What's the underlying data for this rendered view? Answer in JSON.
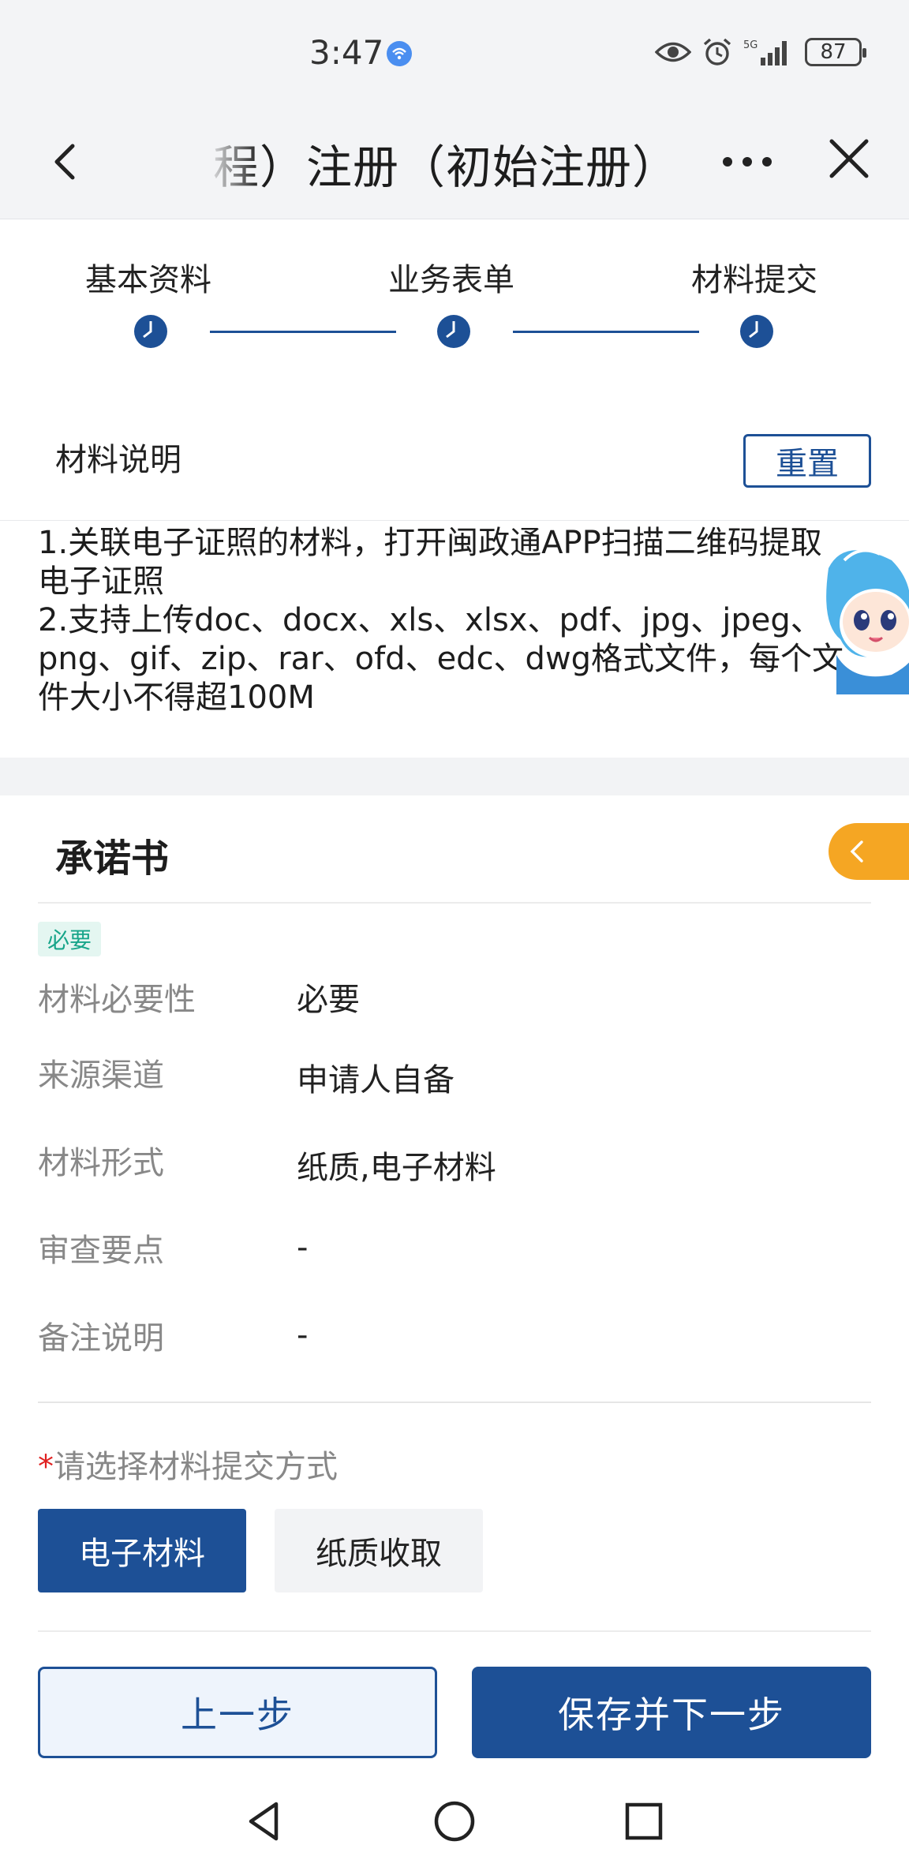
{
  "status_bar": {
    "time": "3:47",
    "network": "5G",
    "battery": "87"
  },
  "nav": {
    "title": "程）注册（初始注册）",
    "back_icon": "chevron-left-icon",
    "more_icon": "more-horizontal-icon",
    "close_icon": "close-icon"
  },
  "steps": [
    {
      "label": "基本资料",
      "icon": "clock-icon"
    },
    {
      "label": "业务表单",
      "icon": "clock-icon"
    },
    {
      "label": "材料提交",
      "icon": "clock-icon"
    }
  ],
  "colors": {
    "primary": "#1d5096",
    "accent": "#f5a623",
    "badge_green": "#18a58a",
    "required": "#e02020"
  },
  "description": {
    "title": "材料说明",
    "reset_label": "重置",
    "lines": [
      "1.关联电子证照的材料，打开闽政通APP扫描二维码提取",
      "电子证照",
      "2.支持上传doc、docx、xls、xlsx、pdf、jpg、jpeg、",
      "png、gif、zip、rar、ofd、edc、dwg格式文件，每个文",
      "件大小不得超100M"
    ]
  },
  "material": {
    "title": "承诺书",
    "badge": "必要",
    "fields": [
      {
        "label": "材料必要性",
        "value": "必要"
      },
      {
        "label": "来源渠道",
        "value": "申请人自备"
      },
      {
        "label": "材料形式",
        "value": "纸质,电子材料"
      },
      {
        "label": "审查要点",
        "value": "-"
      },
      {
        "label": "备注说明",
        "value": "-"
      }
    ],
    "submit_star": "*",
    "submit_label": "请选择材料提交方式",
    "methods": [
      "电子材料",
      "纸质收取"
    ]
  },
  "footer": {
    "prev_label": "上一步",
    "next_label": "保存并下一步"
  },
  "system_nav": [
    "back-triangle-icon",
    "home-circle-icon",
    "recents-square-icon"
  ]
}
